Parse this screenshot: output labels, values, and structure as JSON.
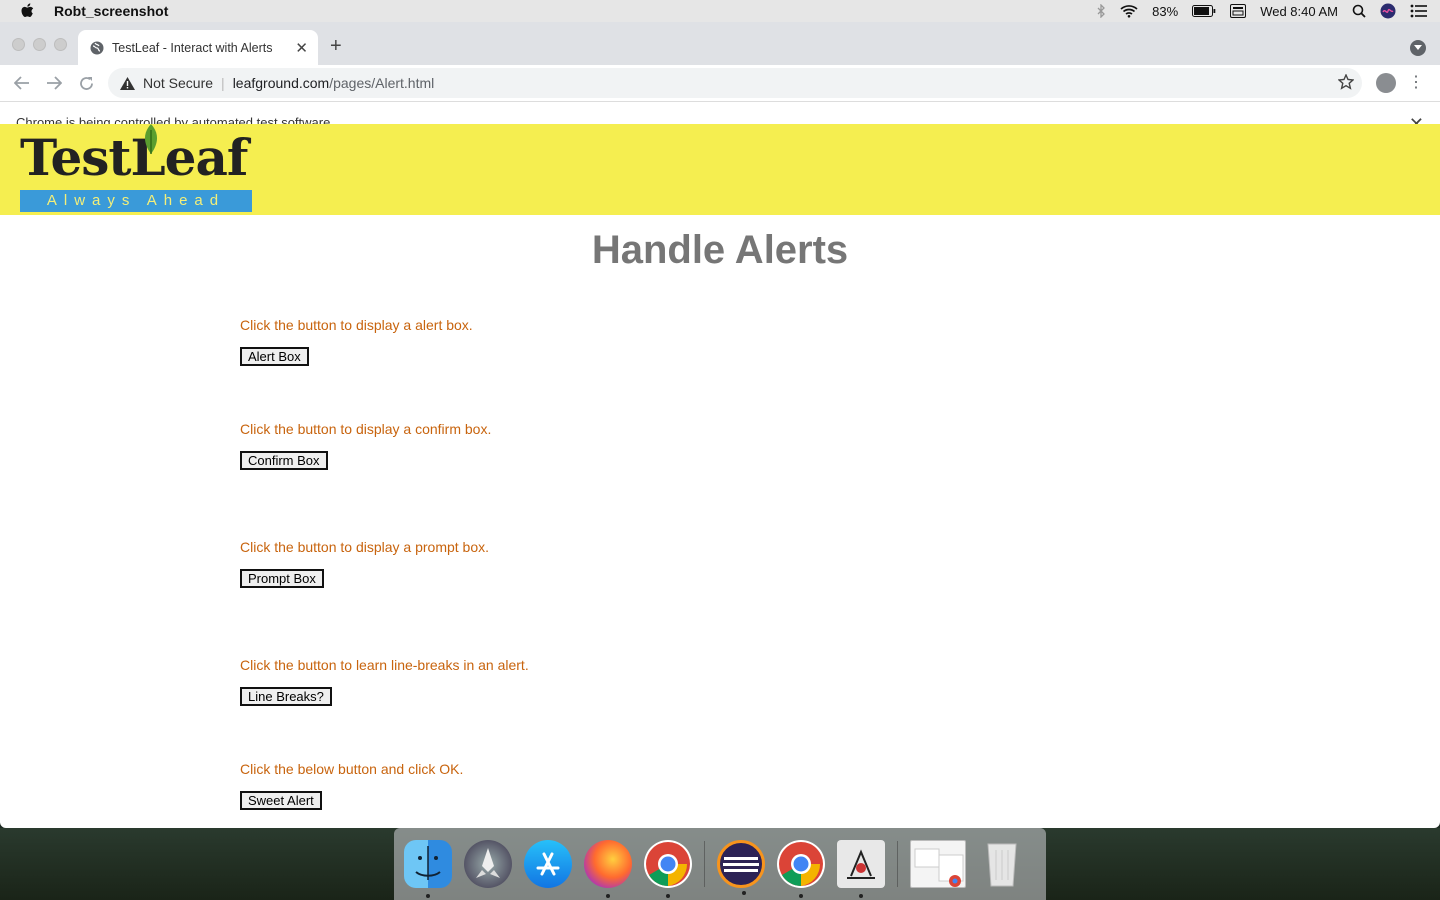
{
  "menubar": {
    "app_name": "Robt_screenshot",
    "battery": "83%",
    "clock": "Wed 8:40 AM"
  },
  "browser": {
    "tab_title": "TestLeaf - Interact with Alerts",
    "security_label": "Not Secure",
    "url_domain": "leafground.com",
    "url_path": "/pages/Alert.html",
    "infobar_text": "Chrome is being controlled by automated test software."
  },
  "page": {
    "logo_text": "TestLeaf",
    "logo_tagline": "Always Ahead",
    "heading": "Handle Alerts",
    "items": [
      {
        "label": "Click the button to display a alert box.",
        "button": "Alert Box"
      },
      {
        "label": "Click the button to display a confirm box.",
        "button": "Confirm Box"
      },
      {
        "label": "Click the button to display a prompt box.",
        "button": "Prompt Box"
      },
      {
        "label": "Click the button to learn line-breaks in an alert.",
        "button": "Line Breaks?"
      },
      {
        "label": "Click the below button and click OK.",
        "button": "Sweet Alert"
      }
    ]
  },
  "dock": {
    "apps": [
      "finder-icon",
      "launchpad-icon",
      "app-store-icon",
      "firefox-icon",
      "chrome-icon",
      "eclipse-icon",
      "chrome-icon",
      "java-icon",
      "preview-icon",
      "trash-icon"
    ]
  },
  "colors": {
    "banner": "#f5ee50",
    "label_orange": "#c8640e",
    "heading_gray": "#767676",
    "logo_blue": "#3a9ad9"
  }
}
